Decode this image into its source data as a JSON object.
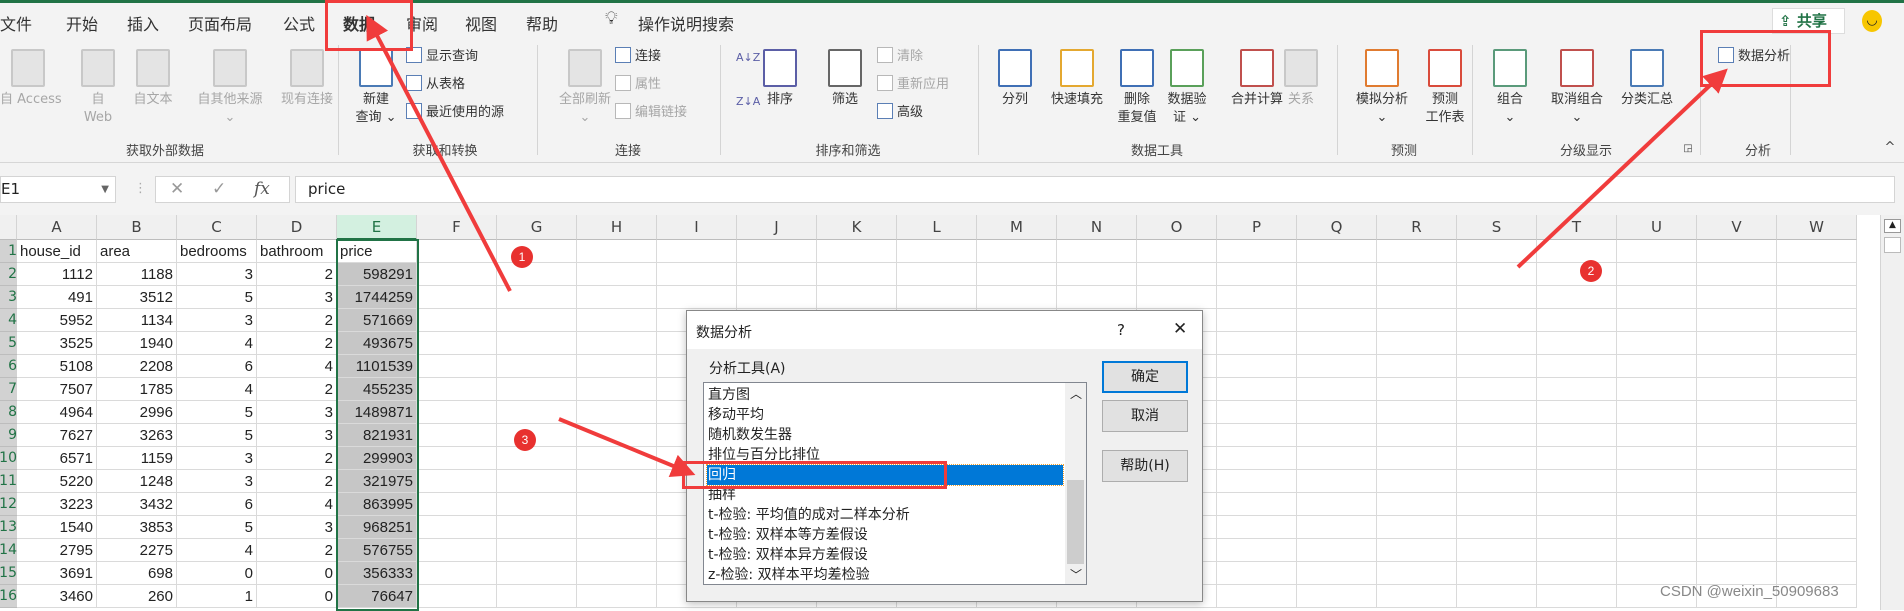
{
  "tabs": [
    "文件",
    "开始",
    "插入",
    "页面布局",
    "公式",
    "数据",
    "审阅",
    "视图",
    "帮助"
  ],
  "active_tab": "数据",
  "tell_me": "操作说明搜索",
  "share": "共享",
  "ribbon": {
    "groups": [
      "获取外部数据",
      "获取和转换",
      "连接",
      "排序和筛选",
      "数据工具",
      "预测",
      "分级显示",
      "分析"
    ],
    "big": [
      {
        "l1": "自 Access",
        "l2": "",
        "dis": true,
        "icon": "access-icon"
      },
      {
        "l1": "自",
        "l2": "Web",
        "dis": true,
        "icon": "web-icon"
      },
      {
        "l1": "自文本",
        "l2": "",
        "dis": true,
        "icon": "text-file-icon"
      },
      {
        "l1": "自其他来源",
        "l2": "⌄",
        "dis": true,
        "icon": "other-sources-icon"
      },
      {
        "l1": "现有连接",
        "l2": "",
        "dis": true,
        "icon": "existing-connections-icon"
      },
      {
        "l1": "新建",
        "l2": "查询 ⌄",
        "dis": false,
        "icon": "new-query-icon"
      },
      {
        "l1": "全部刷新",
        "l2": "⌄",
        "dis": true,
        "icon": "refresh-all-icon"
      },
      {
        "l1": "排序",
        "l2": "",
        "dis": false,
        "icon": "sort-icon"
      },
      {
        "l1": "筛选",
        "l2": "",
        "dis": false,
        "icon": "filter-icon"
      },
      {
        "l1": "分列",
        "l2": "",
        "dis": false,
        "icon": "text-to-columns-icon"
      },
      {
        "l1": "快速填充",
        "l2": "",
        "dis": false,
        "icon": "flash-fill-icon"
      },
      {
        "l1": "删除",
        "l2": "重复值",
        "dis": false,
        "icon": "remove-duplicates-icon"
      },
      {
        "l1": "数据验",
        "l2": "证 ⌄",
        "dis": false,
        "icon": "data-validation-icon"
      },
      {
        "l1": "合并计算",
        "l2": "",
        "dis": false,
        "icon": "consolidate-icon"
      },
      {
        "l1": "关系",
        "l2": "",
        "dis": true,
        "icon": "relationships-icon"
      },
      {
        "l1": "模拟分析",
        "l2": "⌄",
        "dis": false,
        "icon": "what-if-icon"
      },
      {
        "l1": "预测",
        "l2": "工作表",
        "dis": false,
        "icon": "forecast-sheet-icon"
      },
      {
        "l1": "组合",
        "l2": "⌄",
        "dis": false,
        "icon": "group-icon"
      },
      {
        "l1": "取消组合",
        "l2": "⌄",
        "dis": false,
        "icon": "ungroup-icon"
      },
      {
        "l1": "分类汇总",
        "l2": "",
        "dis": false,
        "icon": "subtotal-icon"
      }
    ],
    "small": [
      {
        "label": "显示查询",
        "dis": false,
        "icon": "show-queries-icon"
      },
      {
        "label": "从表格",
        "dis": false,
        "icon": "from-table-icon"
      },
      {
        "label": "最近使用的源",
        "dis": false,
        "icon": "recent-sources-icon"
      },
      {
        "label": "连接",
        "dis": false,
        "icon": "connections-icon"
      },
      {
        "label": "属性",
        "dis": true,
        "icon": "properties-icon"
      },
      {
        "label": "编辑链接",
        "dis": true,
        "icon": "edit-links-icon"
      },
      {
        "label": "清除",
        "dis": true,
        "icon": "clear-icon"
      },
      {
        "label": "重新应用",
        "dis": true,
        "icon": "reapply-icon"
      },
      {
        "label": "高级",
        "dis": false,
        "icon": "advanced-filter-icon"
      },
      {
        "label": "数据分析",
        "dis": false,
        "icon": "data-analysis-icon"
      }
    ]
  },
  "formula_bar": {
    "name_box": "E1",
    "fx": "fx",
    "value": "price"
  },
  "columns": [
    "A",
    "B",
    "C",
    "D",
    "E",
    "F",
    "G",
    "H",
    "I",
    "J",
    "K",
    "L",
    "M",
    "N",
    "O",
    "P",
    "Q",
    "R",
    "S",
    "T",
    "U",
    "V",
    "W"
  ],
  "rows": [
    [
      "house_id",
      "area",
      "bedrooms",
      "bathroom",
      "price"
    ],
    [
      1112,
      1188,
      3,
      2,
      598291
    ],
    [
      491,
      3512,
      5,
      3,
      1744259
    ],
    [
      5952,
      1134,
      3,
      2,
      571669
    ],
    [
      3525,
      1940,
      4,
      2,
      493675
    ],
    [
      5108,
      2208,
      6,
      4,
      1101539
    ],
    [
      7507,
      1785,
      4,
      2,
      455235
    ],
    [
      4964,
      2996,
      5,
      3,
      1489871
    ],
    [
      7627,
      3263,
      5,
      3,
      821931
    ],
    [
      6571,
      1159,
      3,
      2,
      299903
    ],
    [
      5220,
      1248,
      3,
      2,
      321975
    ],
    [
      3223,
      3432,
      6,
      4,
      863995
    ],
    [
      1540,
      3853,
      5,
      3,
      968251
    ],
    [
      2795,
      2275,
      4,
      2,
      576755
    ],
    [
      3691,
      698,
      0,
      0,
      356333
    ],
    [
      3460,
      260,
      1,
      0,
      76647
    ]
  ],
  "dialog": {
    "title": "数据分析",
    "help_glyph": "?",
    "close_glyph": "✕",
    "label": "分析工具(A)",
    "items": [
      "直方图",
      "移动平均",
      "随机数发生器",
      "排位与百分比排位",
      "回归",
      "抽样",
      "t-检验: 平均值的成对二样本分析",
      "t-检验: 双样本等方差假设",
      "t-检验: 双样本异方差假设",
      "z-检验: 双样本平均差检验"
    ],
    "selected": "回归",
    "ok": "确定",
    "cancel": "取消",
    "help": "帮助(H)"
  },
  "annotations": [
    "1",
    "2",
    "3"
  ],
  "accent": "#217346",
  "highlight": "#0078d7",
  "annotation_color": "#f03c3c",
  "watermark": "CSDN @weixin_50909683"
}
